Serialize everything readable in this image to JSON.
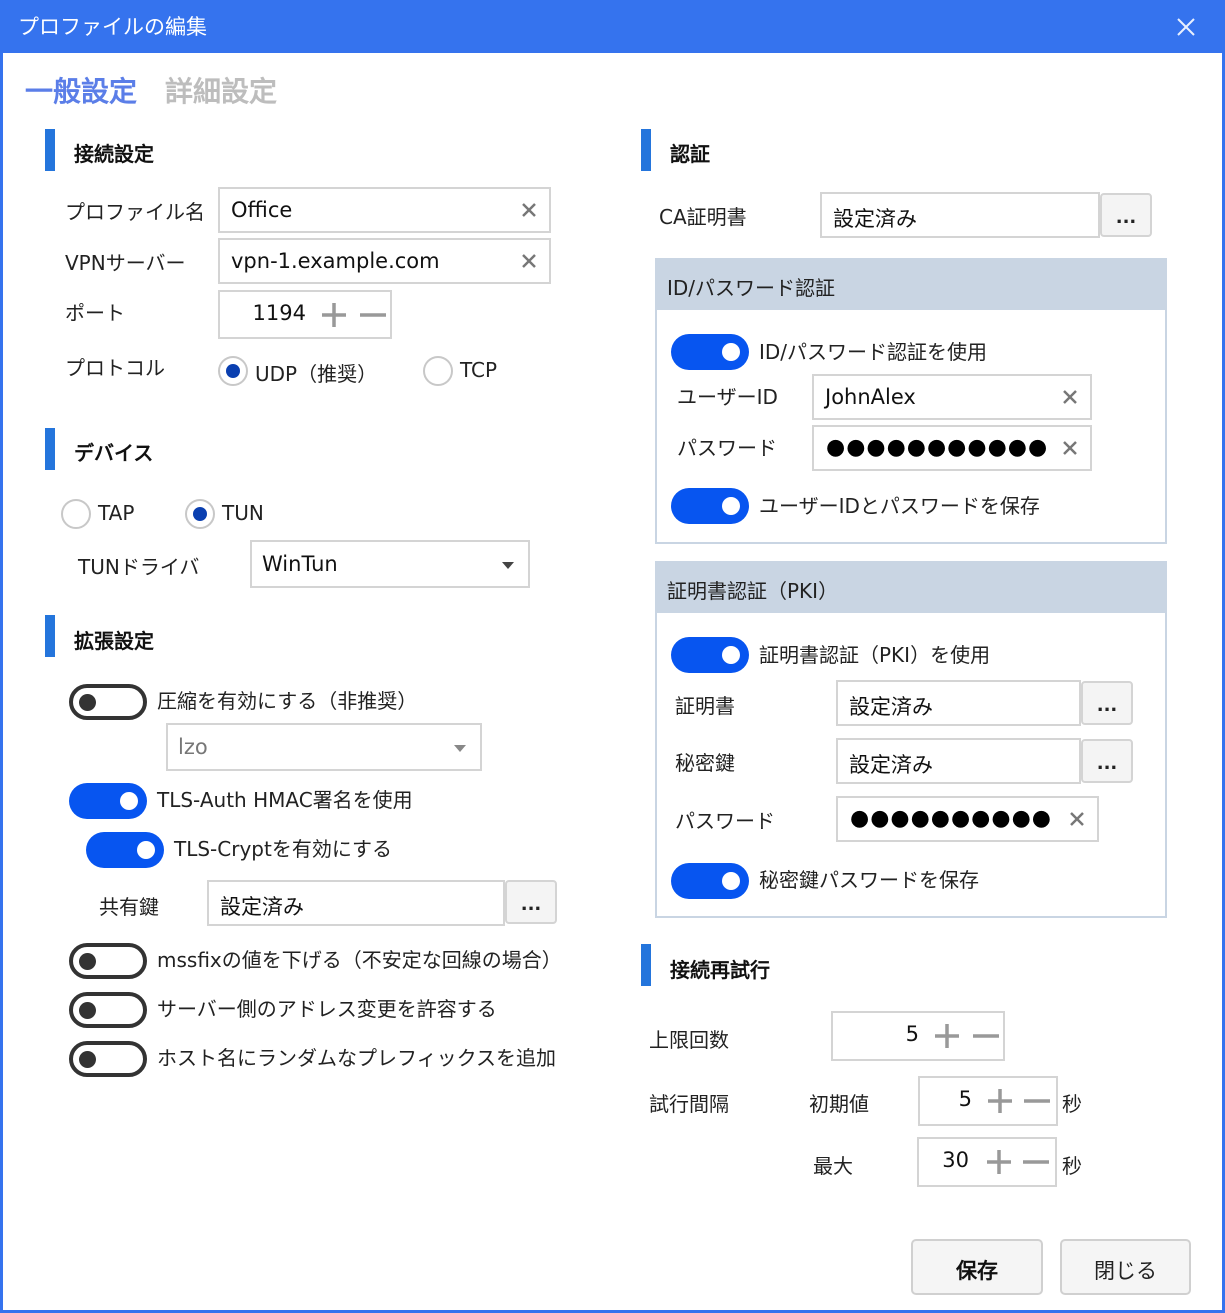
{
  "window": {
    "title": "プロファイルの編集",
    "close_icon": "close-icon"
  },
  "tabs": [
    {
      "label": "一般設定",
      "active": true
    },
    {
      "label": "詳細設定",
      "active": false
    }
  ],
  "colors": {
    "titlebar": "#3573ee",
    "accent": "#0755f0",
    "section_bar": "#2475dc",
    "active_tab": "#5b7ee8",
    "group_header": "#c9d5e3"
  },
  "connection": {
    "title": "接続設定",
    "profile_name": {
      "label": "プロファイル名",
      "value": "Office"
    },
    "vpn_server": {
      "label": "VPNサーバー",
      "value": "vpn-1.example.com"
    },
    "port": {
      "label": "ポート",
      "value": "1194"
    },
    "protocol": {
      "label": "プロトコル",
      "options": [
        {
          "label": "UDP（推奨）",
          "selected": true
        },
        {
          "label": "TCP",
          "selected": false
        }
      ]
    }
  },
  "device": {
    "title": "デバイス",
    "options": [
      {
        "label": "TAP",
        "selected": false
      },
      {
        "label": "TUN",
        "selected": true
      }
    ],
    "tun_driver": {
      "label": "TUNドライバ",
      "value": "WinTun"
    }
  },
  "advanced": {
    "title": "拡張設定",
    "compression": {
      "label": "圧縮を有効にする（非推奨）",
      "on": false,
      "algorithm": "lzo"
    },
    "tls_auth": {
      "label": "TLS-Auth HMAC署名を使用",
      "on": true
    },
    "tls_crypt": {
      "label": "TLS-Cryptを有効にする",
      "on": true
    },
    "shared_key": {
      "label": "共有鍵",
      "value": "設定済み",
      "browse": "..."
    },
    "mssfix": {
      "label": "mssfixの値を下げる（不安定な回線の場合）",
      "on": false
    },
    "float": {
      "label": "サーバー側のアドレス変更を許容する",
      "on": false
    },
    "random_prefix": {
      "label": "ホスト名にランダムなプレフィックスを追加",
      "on": false
    }
  },
  "auth": {
    "title": "認証",
    "ca_cert": {
      "label": "CA証明書",
      "value": "設定済み",
      "browse": "..."
    },
    "id_password": {
      "title": "ID/パスワード認証",
      "use": {
        "label": "ID/パスワード認証を使用",
        "on": true
      },
      "user_id": {
        "label": "ユーザーID",
        "value": "JohnAlex"
      },
      "password": {
        "label": "パスワード",
        "value": "●●●●●●●●●●●●"
      },
      "save": {
        "label": "ユーザーIDとパスワードを保存",
        "on": true
      }
    },
    "pki": {
      "title": "証明書認証（PKI）",
      "use": {
        "label": "証明書認証（PKI）を使用",
        "on": true
      },
      "cert": {
        "label": "証明書",
        "value": "設定済み",
        "browse": "..."
      },
      "private_key": {
        "label": "秘密鍵",
        "value": "設定済み",
        "browse": "..."
      },
      "password": {
        "label": "パスワード",
        "value": "●●●●●●●●●●●●"
      },
      "save": {
        "label": "秘密鍵パスワードを保存",
        "on": true
      }
    }
  },
  "retry": {
    "title": "接続再試行",
    "max_count": {
      "label": "上限回数",
      "value": "5"
    },
    "interval": {
      "label": "試行間隔",
      "initial": {
        "label": "初期値",
        "value": "5",
        "unit": "秒"
      },
      "max": {
        "label": "最大",
        "value": "30",
        "unit": "秒"
      }
    }
  },
  "footer": {
    "save": "保存",
    "close": "閉じる"
  }
}
